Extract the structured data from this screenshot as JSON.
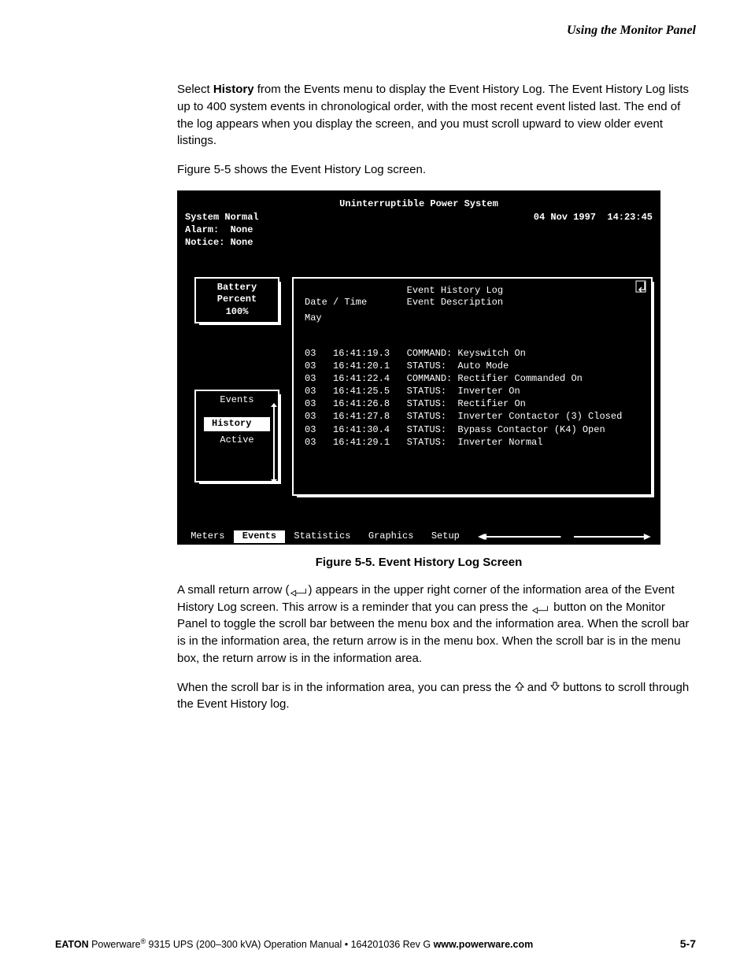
{
  "header": {
    "running": "Using the Monitor Panel"
  },
  "paragraphs": {
    "p1_pre": "Select ",
    "p1_bold": "History",
    "p1_post": " from the Events menu to display the Event History Log. The Event History Log lists up to 400 system events in chronological order, with the most recent event listed last. The end of the log appears when you display the screen, and you must scroll upward to view older event listings.",
    "p2": "Figure 5-5 shows the Event History Log screen.",
    "p3a": "A small return arrow (",
    "p3b": ") appears in the upper right corner of the information area of the Event History Log screen. This arrow is a reminder that you can press the ",
    "p3c": " button on the Monitor Panel to toggle the scroll bar between the menu box and the information area. When the scroll bar is in the information area, the return arrow is in the menu box. When the scroll bar is in the menu box, the return arrow is in the information area.",
    "p4a": "When the scroll bar is in the information area, you can press the ",
    "p4b": " and ",
    "p4c": " buttons to scroll through the Event History log."
  },
  "figure_caption": "Figure 5-5. Event History Log Screen",
  "screen": {
    "title": "Uninterruptible Power System",
    "status": {
      "line1": "System Normal",
      "line2": "Alarm:  None",
      "line3": "Notice: None",
      "datetime": "04 Nov 1997  14:23:45"
    },
    "battery": {
      "l1": "Battery",
      "l2": "Percent",
      "l3": "100%"
    },
    "events_panel": {
      "title": "Events",
      "selected": "History",
      "other": "Active"
    },
    "log": {
      "title": "Event History Log",
      "col1": "Date / Time",
      "col2": "Event Description",
      "month": "May",
      "rows": [
        {
          "d": "03",
          "t": "16:41:19.3",
          "desc": "COMMAND: Keyswitch On"
        },
        {
          "d": "03",
          "t": "16:41:20.1",
          "desc": "STATUS:  Auto Mode"
        },
        {
          "d": "03",
          "t": "16:41:22.4",
          "desc": "COMMAND: Rectifier Commanded On"
        },
        {
          "d": "03",
          "t": "16:41:25.5",
          "desc": "STATUS:  Inverter On"
        },
        {
          "d": "03",
          "t": "16:41:26.8",
          "desc": "STATUS:  Rectifier On"
        },
        {
          "d": "03",
          "t": "16:41:27.8",
          "desc": "STATUS:  Inverter Contactor (3) Closed"
        },
        {
          "d": "03",
          "t": "16:41:30.4",
          "desc": "STATUS:  Bypass Contactor (K4) Open"
        },
        {
          "d": "03",
          "t": "16:41:29.1",
          "desc": "STATUS:  Inverter Normal"
        }
      ]
    },
    "menubar": {
      "items": [
        "Meters",
        "Events",
        "Statistics",
        "Graphics",
        "Setup"
      ],
      "selected_index": 1
    }
  },
  "footer": {
    "brand": "EATON",
    "product_pre": " Powerware",
    "product_post": " 9315 UPS (200–300 kVA) Operation Manual  •  164201036 Rev G  ",
    "url": "www.powerware.com",
    "page": "5-7"
  }
}
